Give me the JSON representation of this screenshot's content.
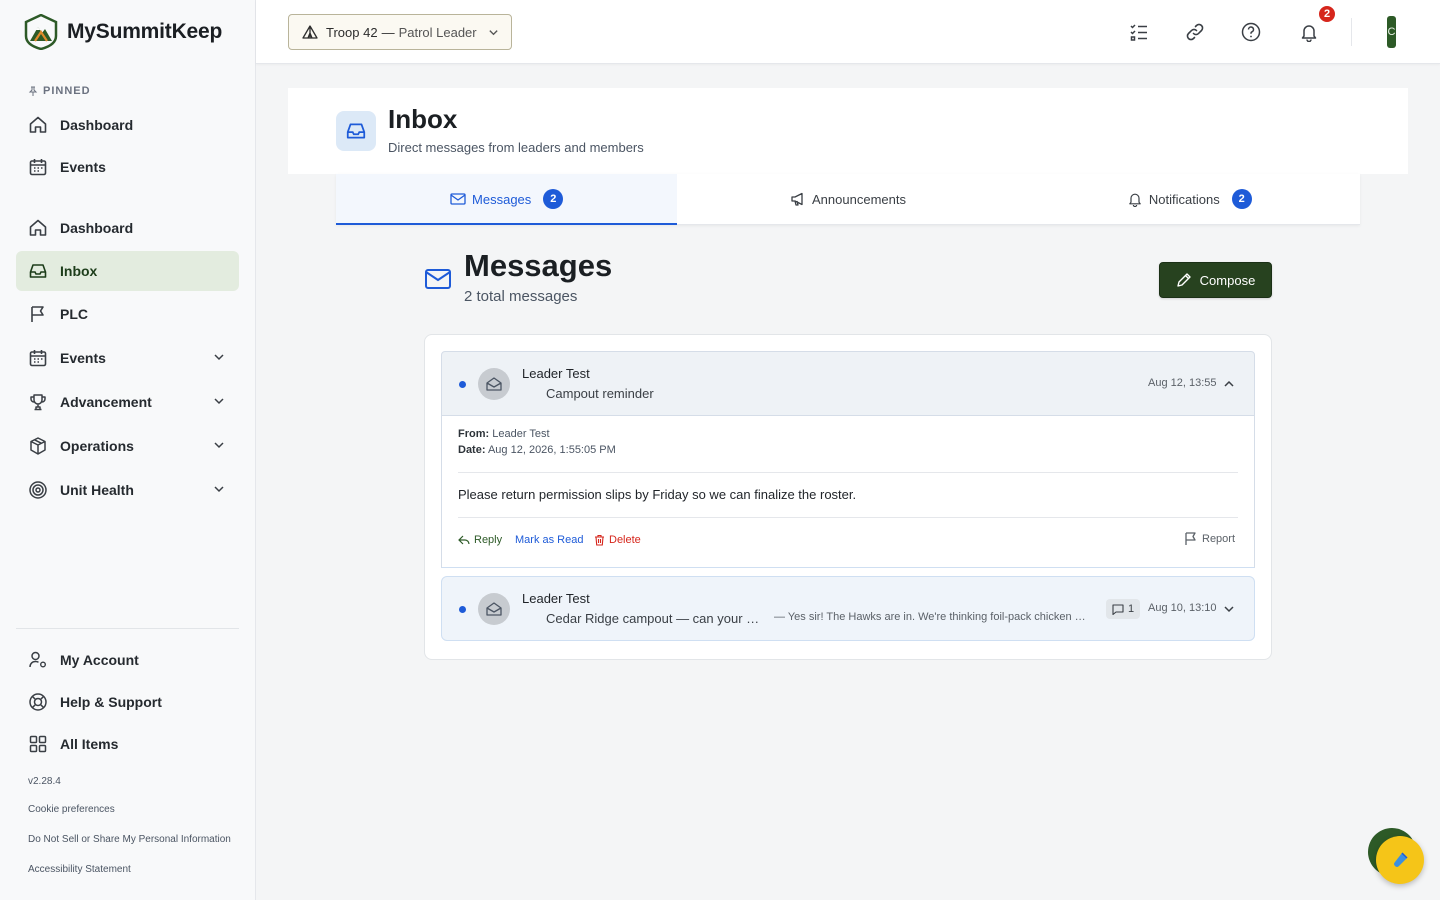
{
  "brand": {
    "name": "MySummitKeep"
  },
  "sidebar": {
    "pinned_label": "PINNED",
    "pinned": [
      {
        "label": "Dashboard",
        "icon": "home-icon"
      },
      {
        "label": "Events",
        "icon": "calendar-icon"
      }
    ],
    "items": [
      {
        "label": "Dashboard",
        "icon": "home-icon"
      },
      {
        "label": "Inbox",
        "icon": "inbox-icon",
        "active": true
      },
      {
        "label": "PLC",
        "icon": "flag-icon"
      },
      {
        "label": "Events",
        "icon": "calendar-icon",
        "expandable": true
      },
      {
        "label": "Advancement",
        "icon": "trophy-icon",
        "expandable": true
      },
      {
        "label": "Operations",
        "icon": "box-icon",
        "expandable": true
      },
      {
        "label": "Unit Health",
        "icon": "target-icon",
        "expandable": true
      }
    ],
    "bottom": [
      {
        "label": "My Account",
        "icon": "user-settings-icon"
      },
      {
        "label": "Help & Support",
        "icon": "lifebuoy-icon"
      },
      {
        "label": "All Items",
        "icon": "grid-icon"
      }
    ],
    "version": "v2.28.4",
    "footer_links": [
      "Cookie preferences",
      "Do Not Sell or Share My Personal Information",
      "Accessibility Statement"
    ]
  },
  "topbar": {
    "unit": "Troop 42",
    "separator": "—",
    "role": "Patrol Leader",
    "notification_count": "2",
    "avatar_initial": "C"
  },
  "page": {
    "title": "Inbox",
    "subtitle": "Direct messages from leaders and members"
  },
  "tabs": [
    {
      "label": "Messages",
      "count": "2",
      "active": true
    },
    {
      "label": "Announcements"
    },
    {
      "label": "Notifications",
      "count": "2"
    }
  ],
  "messages_section": {
    "title": "Messages",
    "count_text": "2 total messages",
    "compose_label": "Compose"
  },
  "messages": [
    {
      "sender": "Leader Test",
      "subject": "Campout reminder",
      "date": "Aug 12, 13:55",
      "expanded": true,
      "unread": true,
      "detail": {
        "from_label": "From:",
        "from": "Leader Test",
        "date_label": "Date:",
        "date": "Aug 12, 2026, 1:55:05 PM",
        "body": "Please return permission slips by Friday so we can finalize the roster."
      },
      "actions": {
        "reply": "Reply",
        "mark_read": "Mark as Read",
        "delete": "Delete",
        "report": "Report"
      }
    },
    {
      "sender": "Leader Test",
      "subject": "Cedar Ridge campout — can your …",
      "preview": "— Yes sir! The Hawks are in. We're thinking foil-pack chicken …",
      "reply_count": "1",
      "date": "Aug 10, 13:10",
      "expanded": false,
      "unread": true
    }
  ],
  "colors": {
    "brand_green": "#27421f",
    "accent_blue": "#1e5bd8",
    "alert_red": "#d6261c",
    "fab_yellow": "#f5c518"
  },
  "fab": {
    "icon": "flask-icon"
  }
}
